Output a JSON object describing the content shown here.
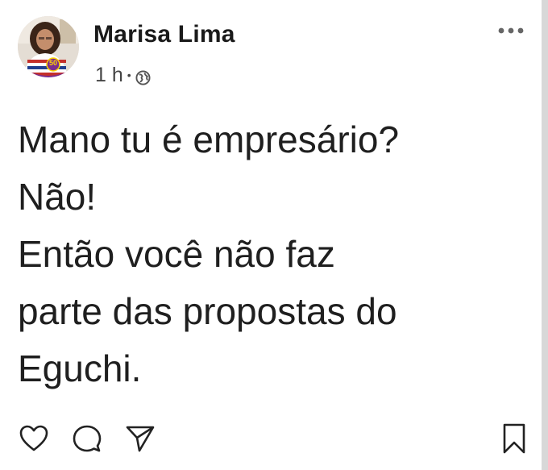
{
  "post": {
    "author": {
      "name": "Marisa Lima",
      "avatar_badge": "50"
    },
    "time": "1 h",
    "separator": "•",
    "visibility_icon": "globe-icon",
    "more_icon": "more-options-icon",
    "text_lines": [
      "Mano tu é empresário?",
      "Não!",
      "Então você não faz",
      "parte das propostas do",
      "Eguchi."
    ]
  },
  "actions": [
    {
      "icon": "heart-icon"
    },
    {
      "icon": "comment-icon"
    },
    {
      "icon": "share-icon"
    },
    {
      "icon": "bookmark-icon"
    }
  ],
  "colors": {
    "text": "#1f1f1f",
    "meta": "#444444",
    "icon": "#222222",
    "background": "#ffffff",
    "badge": "#7b2d8e",
    "badge_text": "#ffd400"
  }
}
